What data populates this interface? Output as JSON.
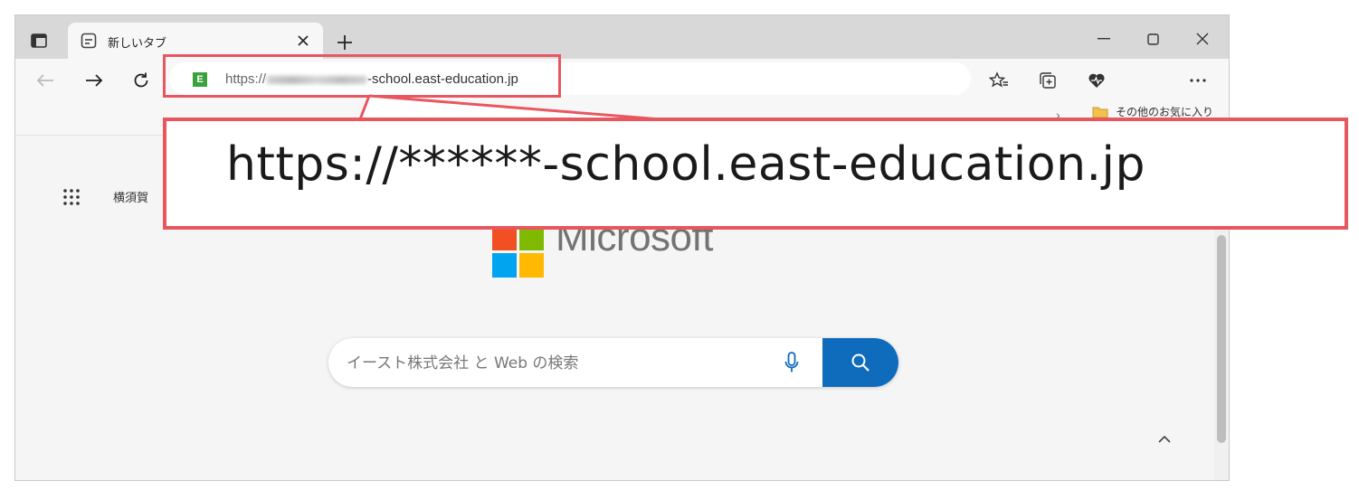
{
  "browser": {
    "tab": {
      "title": "新しいタブ"
    },
    "address_bar": {
      "url_prefix": "https://",
      "url_suffix": "-school.east-education.jp",
      "favicon_letter": "E"
    },
    "favorites_bar": {
      "other_favorites": "その他のお気に入り"
    }
  },
  "new_tab_page": {
    "weather_text": "横須賀",
    "logo_text": "Microsoft",
    "search": {
      "placeholder": "イースト株式会社 と Web の検索"
    }
  },
  "callout": {
    "text": "https://******-school.east-education.jp",
    "border_color": "#e8575f"
  },
  "colors": {
    "accent": "#0f6cbd",
    "highlight": "#e8575f"
  },
  "icons": [
    "tab-actions-icon",
    "new-tab-page-icon",
    "close-icon",
    "plus-icon",
    "minimize-icon",
    "maximize-icon",
    "back-icon",
    "forward-icon",
    "refresh-icon",
    "favorites-star-icon",
    "collections-icon",
    "browser-essentials-icon",
    "more-icon",
    "folder-icon",
    "apps-grid-icon",
    "microphone-icon",
    "search-icon",
    "chevron-up-icon"
  ]
}
